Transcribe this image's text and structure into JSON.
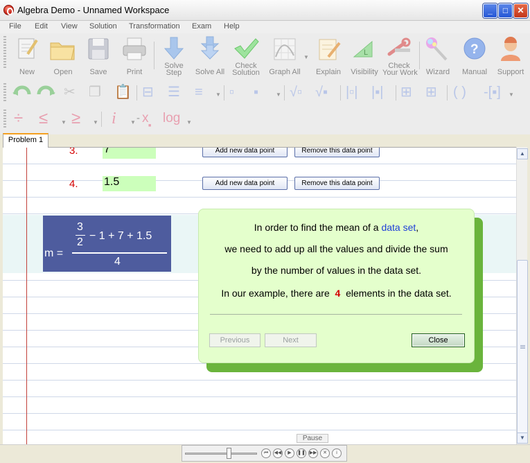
{
  "window": {
    "title": "Algebra Demo - Unnamed Workspace"
  },
  "menu": [
    "File",
    "Edit",
    "View",
    "Solution",
    "Transformation",
    "Exam",
    "Help"
  ],
  "toolbar": {
    "new": "New",
    "open": "Open",
    "save": "Save",
    "print": "Print",
    "solve_step_1": "Solve",
    "solve_step_2": "Step",
    "solve_all": "Solve All",
    "check_solution_1": "Check",
    "check_solution_2": "Solution",
    "graph_all": "Graph All",
    "explain": "Explain",
    "visibility": "Visibility",
    "check_work_1": "Check",
    "check_work_2": "Your Work",
    "wizard": "Wizard",
    "manual": "Manual",
    "support": "Support",
    "symbols": {
      "divide": "÷",
      "le": "≤",
      "ge": "≥",
      "i": "i",
      "x": "x",
      "log": "log",
      "parens": "( )"
    }
  },
  "tabs": [
    "Problem 1"
  ],
  "rows": [
    {
      "index": "3.",
      "value": "7",
      "add_label": "Add new data point",
      "remove_label": "Remove this data point"
    },
    {
      "index": "4.",
      "value": "1.5",
      "add_label": "Add new data point",
      "remove_label": "Remove this data point"
    }
  ],
  "formula": {
    "lhs": "m =",
    "frac_num": "3",
    "frac_den": "2",
    "numerator_rest": "− 1 + 7 + 1.5",
    "denominator": "4"
  },
  "popup": {
    "line1_pre": "In order to find the mean of a",
    "line1_link": "data set",
    "line1_post": ",",
    "line2": "we need to add up all the values and divide the sum",
    "line3": "by the number of values in the data set.",
    "line4_pre": "In our example, there are",
    "line4_count": "4",
    "line4_post": "elements in the data set.",
    "prev": "Previous",
    "next": "Next",
    "close": "Close"
  },
  "player": {
    "pause": "Pause",
    "progress": 0.62
  },
  "colors": {
    "accent_red": "#d40000",
    "popup_bg": "#e4ffcc",
    "popup_shadow": "#6ab43c",
    "formula_bg": "#4e5c9e",
    "link_blue": "#1f3fd8"
  }
}
